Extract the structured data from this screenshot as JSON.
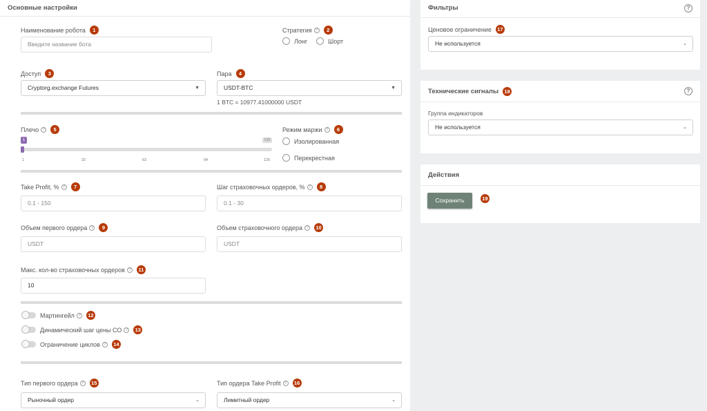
{
  "main": {
    "title": "Основные настройки",
    "robot_name": {
      "label": "Наименование робота",
      "badge": "1",
      "placeholder": "Введите название бота"
    },
    "strategy": {
      "label": "Стратегия",
      "badge": "2",
      "options": [
        "Лонг",
        "Шорт"
      ]
    },
    "access": {
      "label": "Доступ",
      "badge": "3",
      "value": "Cryptorg.exchange Futures"
    },
    "pair": {
      "label": "Пара",
      "badge": "4",
      "value": "USDT-BTC",
      "rate": "1 BTC = 10977.41000000 USDT"
    },
    "leverage": {
      "label": "Плечо",
      "badge": "5",
      "value": 1,
      "max": 125,
      "value_text": "1",
      "max_text": "125",
      "ticks": [
        "1",
        "32",
        "63",
        "94",
        "125"
      ]
    },
    "margin_mode": {
      "label": "Режим маржи",
      "badge": "6",
      "options": [
        "Изолированная",
        "Перекрестная"
      ]
    },
    "take_profit": {
      "label": "Take Profit, %",
      "badge": "7",
      "placeholder": "0.1 - 150"
    },
    "safety_step": {
      "label": "Шаг страховочных ордеров, %",
      "badge": "8",
      "placeholder": "0.1 - 30"
    },
    "first_order_volume": {
      "label": "Объем первого ордера",
      "badge": "9",
      "placeholder": "USDT"
    },
    "safety_order_volume": {
      "label": "Объем страховочного ордера",
      "badge": "10",
      "placeholder": "USDT"
    },
    "max_safety_orders": {
      "label": "Макс. кол-во страховочных ордеров",
      "badge": "11",
      "value": "10"
    },
    "toggles": [
      {
        "label": "Мартингейл",
        "badge": "12"
      },
      {
        "label": "Динамический шаг цены СО",
        "badge": "13"
      },
      {
        "label": "Ограничение циклов",
        "badge": "14"
      }
    ],
    "first_order_type": {
      "label": "Тип первого ордера",
      "badge": "15",
      "value": "Рыночный ордер"
    },
    "tp_order_type": {
      "label": "Тип ордера Take Profit",
      "badge": "16",
      "value": "Лимитный ордер"
    }
  },
  "filters": {
    "title": "Фильтры",
    "price_limit": {
      "label": "Ценовое ограничение",
      "badge": "17",
      "value": "Не используется"
    }
  },
  "signals": {
    "title": "Технические сигналы",
    "badge": "18",
    "indicator_group": {
      "label": "Группа индикаторов",
      "value": "Не используется"
    }
  },
  "actions": {
    "title": "Действия",
    "save_label": "Сохранить",
    "badge": "19"
  },
  "icons": {
    "help": "question-circle-icon",
    "dropdown": "chevron-down-icon"
  },
  "colors": {
    "badge": "#b73b0a",
    "save_button": "#6f8278",
    "slider_thumb": "#8e6bb0"
  }
}
